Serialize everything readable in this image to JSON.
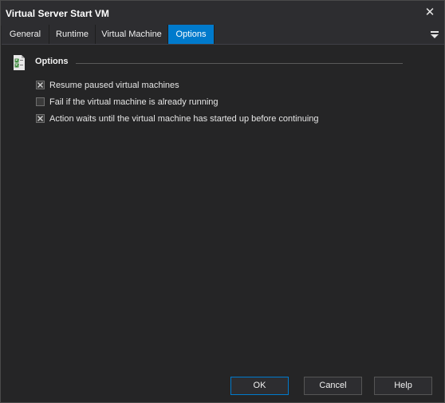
{
  "window": {
    "title": "Virtual Server Start VM",
    "close_glyph": "✕"
  },
  "tabs": [
    {
      "label": "General",
      "active": false
    },
    {
      "label": "Runtime",
      "active": false
    },
    {
      "label": "Virtual Machine",
      "active": false
    },
    {
      "label": "Options",
      "active": true
    }
  ],
  "tab_menu_icon": "menu-arrow-icon",
  "group": {
    "title": "Options",
    "icon": "checklist-icon"
  },
  "options": [
    {
      "label": "Resume paused virtual machines",
      "checked": true
    },
    {
      "label": "Fail if the virtual machine is already running",
      "checked": false
    },
    {
      "label": "Action waits until the virtual machine has started up before continuing",
      "checked": true
    }
  ],
  "buttons": {
    "ok": "OK",
    "cancel": "Cancel",
    "help": "Help"
  },
  "colors": {
    "accent": "#007acc",
    "background": "#252526",
    "titlebar": "#2d2d30"
  }
}
